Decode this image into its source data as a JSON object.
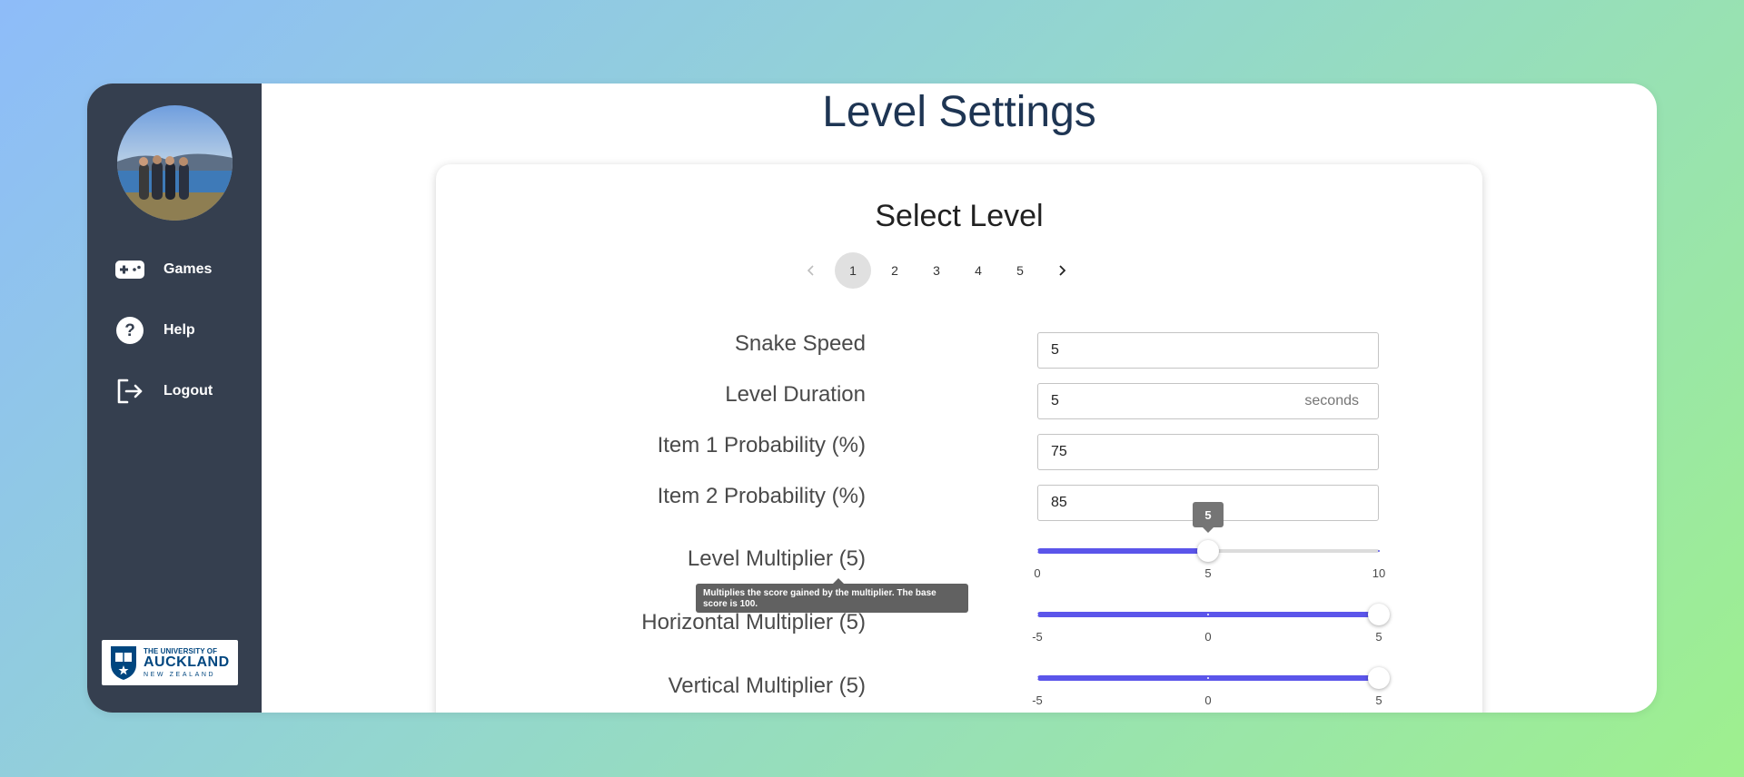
{
  "sidebar": {
    "nav": [
      {
        "label": "Games",
        "icon": "gamepad-icon"
      },
      {
        "label": "Help",
        "icon": "help-circle-icon"
      },
      {
        "label": "Logout",
        "icon": "logout-icon"
      }
    ],
    "logo": {
      "line1": "THE UNIVERSITY OF",
      "line2": "AUCKLAND",
      "line3": "NEW ZEALAND"
    }
  },
  "page": {
    "title": "Level Settings"
  },
  "card": {
    "title": "Select Level",
    "pagination": {
      "prev_icon": "chevron-left-icon",
      "next_icon": "chevron-right-icon",
      "pages": [
        "1",
        "2",
        "3",
        "4",
        "5"
      ],
      "active": "1"
    }
  },
  "form": {
    "snake_speed": {
      "label": "Snake Speed",
      "value": "5"
    },
    "level_duration": {
      "label": "Level Duration",
      "value": "5",
      "unit": "seconds"
    },
    "item1_probability": {
      "label": "Item 1 Probability (%)",
      "value": "75"
    },
    "item2_probability": {
      "label": "Item 2 Probability (%)",
      "value": "85"
    },
    "level_multiplier": {
      "label": "Level Multiplier (5)",
      "min": 0,
      "max": 10,
      "value": 5,
      "value_label": "5",
      "marks": [
        "0",
        "5",
        "10"
      ]
    },
    "horizontal_multiplier": {
      "label": "Horizontal Multiplier (5)",
      "min": -5,
      "max": 5,
      "value": 5,
      "marks": [
        "-5",
        "0",
        "5"
      ]
    },
    "vertical_multiplier": {
      "label": "Vertical Multiplier (5)",
      "min": -5,
      "max": 5,
      "value": 5,
      "marks": [
        "-5",
        "0",
        "5"
      ]
    },
    "tooltip": "Multiplies the score gained by the multiplier. The base score is 100."
  },
  "colors": {
    "sidebar": "#353f4f",
    "accent": "#5b55ea",
    "title": "#1e3553"
  }
}
